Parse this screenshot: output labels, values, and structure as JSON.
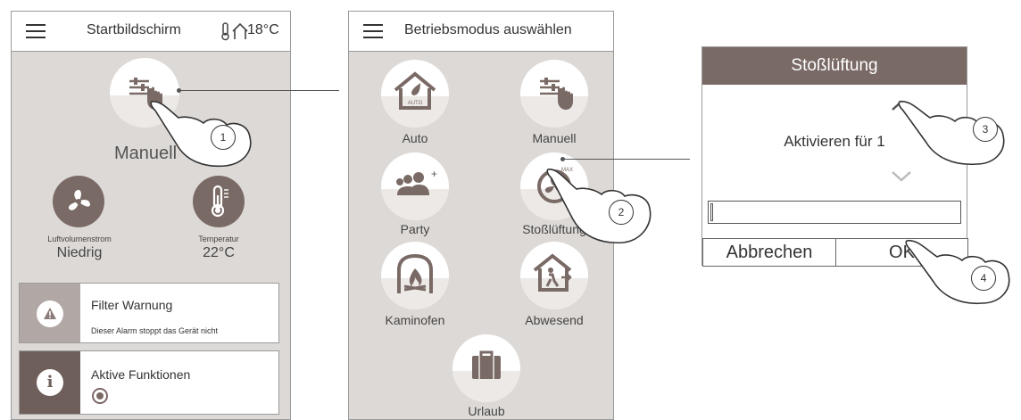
{
  "screen1": {
    "title": "Startbildschirm",
    "temperature": "18°C",
    "mode_label": "Manuell",
    "airflow_label": "Luftvolumenstrom",
    "airflow_value": "Niedrig",
    "temp_label": "Temperatur",
    "temp_value": "22°C",
    "alarm_title": "Filter Warnung",
    "alarm_text": "Dieser Alarm stoppt das Gerät nicht",
    "active_title": "Aktive Funktionen",
    "alarm_side_color": "#b1a7a4",
    "active_side_color": "#6f5f5b"
  },
  "screen2": {
    "title": "Betriebsmodus auswählen",
    "modes": [
      {
        "label": "Auto",
        "icon": "auto-house-icon"
      },
      {
        "label": "Manuell",
        "icon": "manual-slider-hand-icon"
      },
      {
        "label": "Party",
        "icon": "party-people-icon"
      },
      {
        "label": "Stoßlüftung",
        "icon": "boost-max-icon"
      },
      {
        "label": "Kaminofen",
        "icon": "fireplace-icon"
      },
      {
        "label": "Abwesend",
        "icon": "away-house-icon"
      },
      {
        "label": "Urlaub",
        "icon": "suitcase-icon"
      }
    ]
  },
  "dialog": {
    "title": "Stoßlüftung",
    "text": "Aktivieren für 1",
    "cancel": "Abbrechen",
    "ok": "OK",
    "header_color": "#7a6a66"
  },
  "callouts": [
    "1",
    "2",
    "3",
    "4"
  ]
}
